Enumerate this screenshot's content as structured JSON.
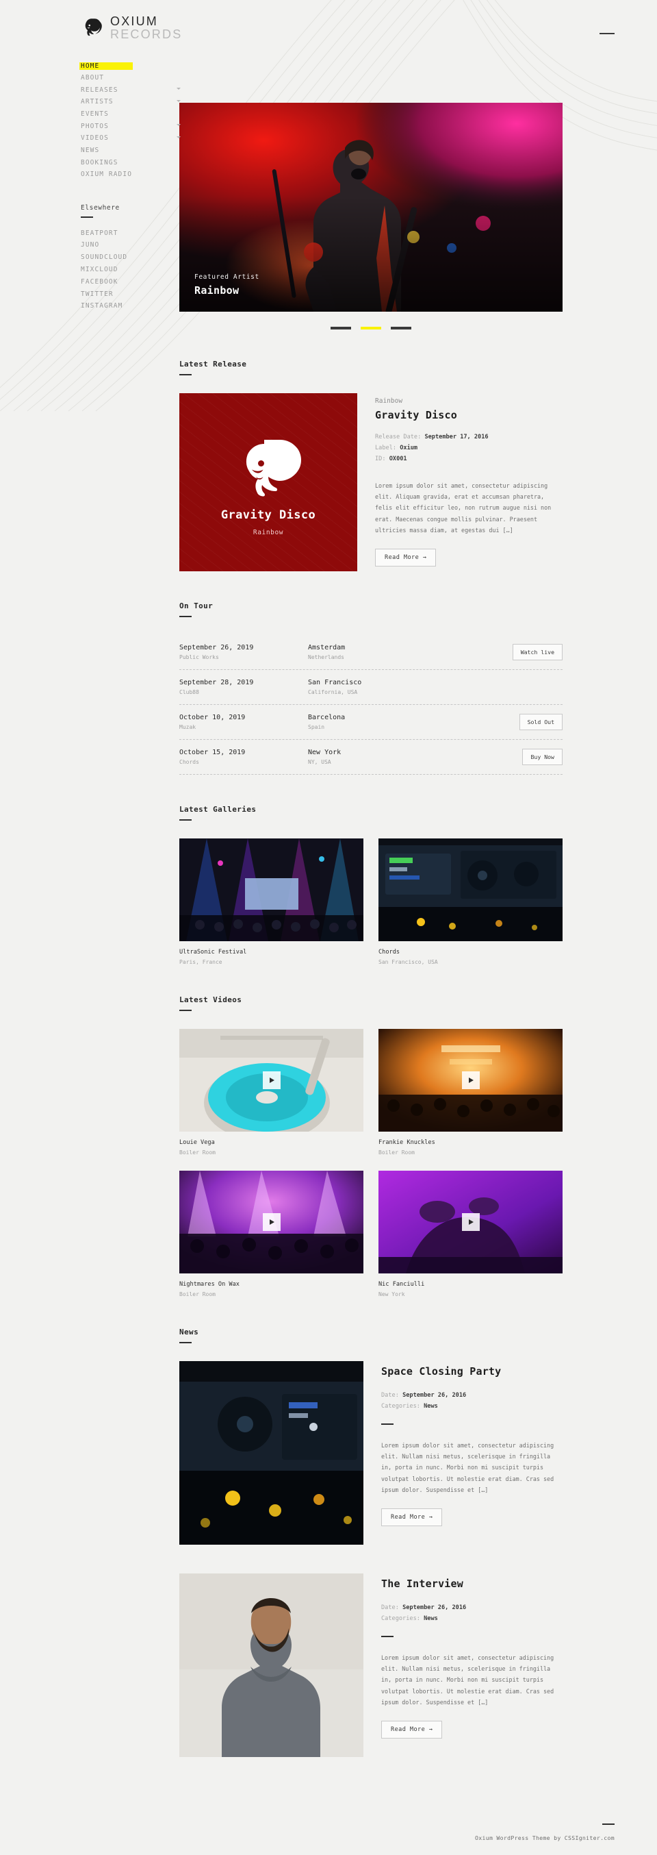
{
  "brand": {
    "line1": "OXIUM",
    "line2": "RECORDS",
    "logo_icon": "lion-head-icon"
  },
  "header": {
    "menu_toggle_icon": "menu-bar-icon"
  },
  "sidebar": {
    "nav": [
      {
        "label": "HOME",
        "active": true,
        "has_children": false
      },
      {
        "label": "ABOUT",
        "active": false,
        "has_children": false
      },
      {
        "label": "RELEASES",
        "active": false,
        "has_children": true
      },
      {
        "label": "ARTISTS",
        "active": false,
        "has_children": true
      },
      {
        "label": "EVENTS",
        "active": false,
        "has_children": false
      },
      {
        "label": "PHOTOS",
        "active": false,
        "has_children": true
      },
      {
        "label": "VIDEOS",
        "active": false,
        "has_children": true
      },
      {
        "label": "NEWS",
        "active": false,
        "has_children": false
      },
      {
        "label": "BOOKINGS",
        "active": false,
        "has_children": false
      },
      {
        "label": "OXIUM RADIO",
        "active": false,
        "has_children": false
      }
    ],
    "elsewhere_heading": "Elsewhere",
    "elsewhere": [
      {
        "label": "BEATPORT"
      },
      {
        "label": "JUNO"
      },
      {
        "label": "SOUNDCLOUD"
      },
      {
        "label": "MIXCLOUD"
      },
      {
        "label": "FACEBOOK"
      },
      {
        "label": "TWITTER"
      },
      {
        "label": "INSTAGRAM"
      }
    ]
  },
  "hero": {
    "eyebrow": "Featured Artist",
    "title": "Rainbow",
    "slides": [
      {
        "active": false
      },
      {
        "active": true
      },
      {
        "active": false
      }
    ],
    "accent": "#faf207"
  },
  "latest_release": {
    "section_title": "Latest Release",
    "artwork": {
      "title": "Gravity Disco",
      "subtitle": "Rainbow",
      "bg_color": "#8e0a0a",
      "icon": "lion-head-icon"
    },
    "artist": "Rainbow",
    "title": "Gravity Disco",
    "meta": [
      {
        "label": "Release Date:",
        "value": "September 17, 2016"
      },
      {
        "label": "Label:",
        "value": "Oxium"
      },
      {
        "label": "ID:",
        "value": "OX001"
      }
    ],
    "excerpt": "Lorem ipsum dolor sit amet, consectetur adipiscing elit. Aliquam gravida, erat et accumsan pharetra, felis elit efficitur leo, non rutrum augue nisi non erat. Maecenas congue mollis pulvinar. Praesent ultricies massa diam, at egestas dui […]",
    "button": "Read More  →"
  },
  "on_tour": {
    "section_title": "On Tour",
    "rows": [
      {
        "date": "September 26, 2019",
        "venue": "Public Works",
        "city": "Amsterdam",
        "region": "Netherlands",
        "action": "Watch live"
      },
      {
        "date": "September 28, 2019",
        "venue": "Club88",
        "city": "San Francisco",
        "region": "California, USA",
        "action": ""
      },
      {
        "date": "October 10, 2019",
        "venue": "Muzak",
        "city": "Barcelona",
        "region": "Spain",
        "action": "Sold Out"
      },
      {
        "date": "October 15, 2019",
        "venue": "Chords",
        "city": "New York",
        "region": "NY, USA",
        "action": "Buy Now"
      }
    ]
  },
  "latest_galleries": {
    "section_title": "Latest Galleries",
    "items": [
      {
        "title": "UltraSonic Festival",
        "subtitle": "Paris, France",
        "image": "concert-stage-photo"
      },
      {
        "title": "Chords",
        "subtitle": "San Francisco, USA",
        "image": "dj-mixer-photo"
      }
    ]
  },
  "latest_videos": {
    "section_title": "Latest Videos",
    "items": [
      {
        "title": "Louie Vega",
        "subtitle": "Boiler Room",
        "image": "turntable-photo",
        "play_icon": "play-icon"
      },
      {
        "title": "Frankie Knuckles",
        "subtitle": "Boiler Room",
        "image": "crowd-lights-photo",
        "play_icon": "play-icon"
      },
      {
        "title": "Nightmares On Wax",
        "subtitle": "Boiler Room",
        "image": "purple-crowd-photo",
        "play_icon": "play-icon"
      },
      {
        "title": "Nic Fanciulli",
        "subtitle": "New York",
        "image": "dj-hands-photo",
        "play_icon": "play-icon"
      }
    ]
  },
  "news": {
    "section_title": "News",
    "items": [
      {
        "title": "Space Closing Party",
        "meta": [
          {
            "label": "Date:",
            "value": "September 26, 2016"
          },
          {
            "label": "Categories:",
            "value": "News"
          }
        ],
        "excerpt": "Lorem ipsum dolor sit amet, consectetur adipiscing elit. Nullam nisi metus, scelerisque in fringilla in, porta in nunc. Morbi non mi suscipit turpis volutpat lobortis. Ut molestie erat diam. Cras sed ipsum dolor. Suspendisse et […]",
        "button": "Read More  →",
        "image": "dj-deck-photo"
      },
      {
        "title": "The Interview",
        "meta": [
          {
            "label": "Date:",
            "value": "September 26, 2016"
          },
          {
            "label": "Categories:",
            "value": "News"
          }
        ],
        "excerpt": "Lorem ipsum dolor sit amet, consectetur adipiscing elit. Nullam nisi metus, scelerisque in fringilla in, porta in nunc. Morbi non mi suscipit turpis volutpat lobortis. Ut molestie erat diam. Cras sed ipsum dolor. Suspendisse et […]",
        "button": "Read More  →",
        "image": "portrait-man-photo"
      }
    ]
  },
  "footer": {
    "text": "Oxium WordPress Theme by CSSIgniter.com"
  }
}
